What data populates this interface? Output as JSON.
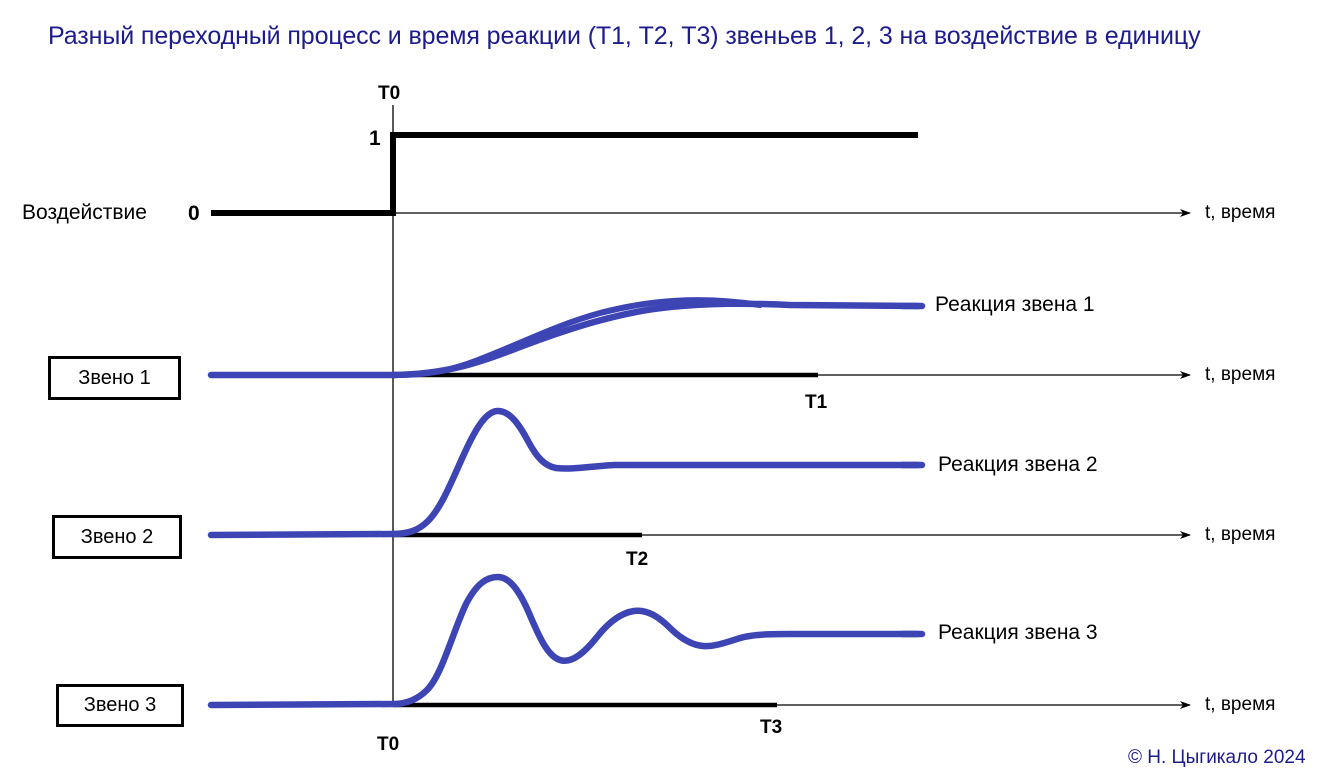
{
  "title": "Разный переходный процесс и время реакции (Т1, Т2, Т3) звеньев 1, 2, 3 на воздействие в единицу",
  "copyright": "© Н. Цыгикало 2024",
  "colors": {
    "title": "#1c1c8e",
    "curve": "#3d44b4",
    "axis": "#000000",
    "step": "#000000",
    "copyright": "#1c1c8e"
  },
  "markers": {
    "t0_top": "T0",
    "t0_bottom": "T0",
    "t1": "T1",
    "t2": "T2",
    "t3": "T3"
  },
  "input": {
    "name": "Воздействие",
    "level_low": "0",
    "level_high": "1",
    "axis_label": "t, время"
  },
  "rows": [
    {
      "box_label": "Звено 1",
      "curve_label": "Реакция звена 1",
      "axis_label": "t, время",
      "time_marker": "T1"
    },
    {
      "box_label": "Звено 2",
      "curve_label": "Реакция звена 2",
      "axis_label": "t, время",
      "time_marker": "T2"
    },
    {
      "box_label": "Звено 3",
      "curve_label": "Реакция звена 3",
      "axis_label": "t, время",
      "time_marker": "T3"
    }
  ],
  "chart_data": {
    "type": "line",
    "title": "Разный переходный процесс и время реакции (Т1, Т2, Т3) звеньев 1, 2, 3 на воздействие в единицу",
    "xlabel": "t, время",
    "ylabel": "",
    "grid": false,
    "legend": "inline-right",
    "annotations": [
      "T0",
      "T1",
      "T2",
      "T3",
      "0",
      "1"
    ],
    "series": [
      {
        "name": "Воздействие",
        "kind": "step",
        "description": "Единичный ступенчатый сигнал: 0 до момента T0, затем 1",
        "x": [
          0,
          0.0,
          1.0
        ],
        "values": [
          0,
          1,
          1
        ]
      },
      {
        "name": "Реакция звена 1",
        "kind": "aperiodic",
        "description": "Апериодическое звено: монотонный выход на установившееся значение к моменту T1",
        "settling_time_marker": "T1",
        "overshoot_percent": 0,
        "x": [
          0.0,
          0.1,
          0.2,
          0.3,
          0.4,
          0.5,
          0.6,
          0.7,
          0.8,
          0.9,
          1.0
        ],
        "values": [
          0.0,
          0.09,
          0.26,
          0.44,
          0.62,
          0.77,
          0.88,
          0.95,
          0.99,
          1.0,
          1.0
        ]
      },
      {
        "name": "Реакция звена 2",
        "kind": "oscillatory-damped",
        "description": "Колебательное звено с одним перерегулированием, установление к моменту T2",
        "settling_time_marker": "T2",
        "overshoot_percent": 72,
        "x": [
          0.0,
          0.08,
          0.14,
          0.2,
          0.26,
          0.32,
          0.4,
          0.5,
          0.6,
          0.7,
          0.85,
          1.0
        ],
        "values": [
          0.0,
          0.1,
          0.45,
          0.95,
          1.72,
          1.6,
          1.3,
          1.1,
          1.02,
          1.0,
          1.0,
          1.0
        ]
      },
      {
        "name": "Реакция звена 3",
        "kind": "oscillatory-underdamped",
        "description": "Слабо демпфированное колебательное звено: несколько затухающих колебаний, установление к моменту T3",
        "settling_time_marker": "T3",
        "overshoot_percent": 85,
        "x": [
          0.0,
          0.08,
          0.16,
          0.24,
          0.32,
          0.42,
          0.5,
          0.58,
          0.66,
          0.74,
          0.82,
          0.9,
          1.0
        ],
        "values": [
          0.0,
          0.12,
          0.75,
          1.85,
          1.6,
          0.55,
          0.42,
          1.0,
          1.28,
          1.05,
          0.82,
          0.9,
          0.9
        ]
      }
    ]
  }
}
